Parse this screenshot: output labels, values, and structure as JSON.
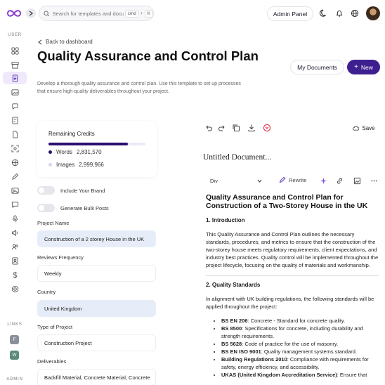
{
  "topbar": {
    "search_placeholder": "Search for templates and documents...",
    "shortcut_cmd": "cmd",
    "shortcut_plus": "+",
    "shortcut_key": "K",
    "admin_label": "Admin Panel"
  },
  "sidebar": {
    "user_heading": "USER",
    "links_heading": "LINKS",
    "admin_heading": "ADMIN",
    "link_badges": [
      {
        "letter": "F",
        "color": "#8a8f99"
      },
      {
        "letter": "W",
        "color": "#5b8a7a"
      }
    ]
  },
  "header": {
    "back_label": "Back to dashboard",
    "title": "Quality Assurance and Control Plan",
    "description": "Develop a thorough quality assurance and control plan. Use this template to set up processes that ensure high-quality deliverables throughout your project.",
    "my_documents_label": "My Documents",
    "new_label": "New"
  },
  "credits": {
    "title": "Remaining Credits",
    "progress": 0.82,
    "words_label": "Words",
    "words_value": "2,831,570",
    "images_label": "Images",
    "images_value": "2,999,966"
  },
  "toggles": {
    "include_brand": "Include Your Brand",
    "bulk_posts": "Generate Bulk Posts"
  },
  "form": {
    "project_name_label": "Project Name",
    "project_name_value": "Construction of a 2 storey House in the UK",
    "frequency_label": "Reviews Frequency",
    "frequency_value": "Weekly",
    "country_label": "Country",
    "country_value": "United Kingdom",
    "type_label": "Type of Project",
    "type_value": "Construction Project",
    "deliverables_label": "Deliverables",
    "deliverables_value": "Backfill Material, Concrete Material, Concrete"
  },
  "editor": {
    "save_label": "Save",
    "doc_title": "Untitled Document...",
    "block_type": "Div",
    "rewrite_label": "Rewrite"
  },
  "document": {
    "heading": "Quality Assurance and Control Plan for Construction of a Two-Storey House in the UK",
    "section1_title": "1. Introduction",
    "section1_body": "This Quality Assurance and Control Plan outlines the necessary standards, procedures, and metrics to ensure that the construction of the two-storey house meets regulatory requirements, client expectations, and industry best practices. Quality control will be implemented throughout the project lifecycle, focusing on the quality of materials and workmanship.",
    "section2_title": "2. Quality Standards",
    "section2_body": "In alignment with UK building regulations, the following standards will be applied throughout the project:",
    "standards": [
      {
        "code": "BS EN 206",
        "desc": ": Concrete - Standard for concrete quality."
      },
      {
        "code": "BS 8500",
        "desc": ": Specifications for concrete, including durability and strength requirements."
      },
      {
        "code": "BS 5628",
        "desc": ": Code of practice for the use of masonry."
      },
      {
        "code": "BS EN ISO 9001",
        "desc": ": Quality management systems standard."
      },
      {
        "code": "Building Regulations 2010",
        "desc": ": Compliance with requirements for safety, energy efficiency, and accessibility."
      },
      {
        "code": "UKAS (United Kingdom Accreditation Service)",
        "desc": ": Ensure that"
      }
    ]
  },
  "colors": {
    "brand": "#3d1f8f",
    "accent_light": "#efe9fb",
    "field_highlight": "#e7edf8",
    "delete_icon": "#e0384a"
  }
}
